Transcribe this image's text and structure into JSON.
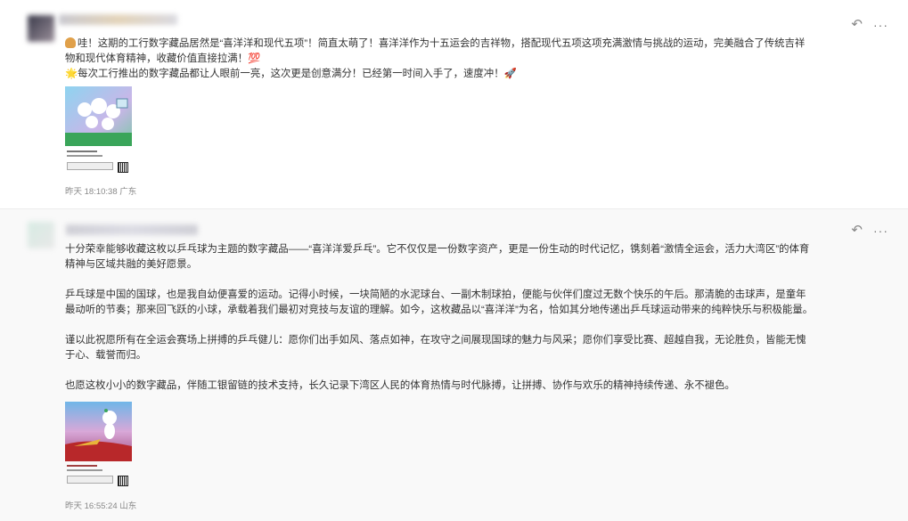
{
  "posts": [
    {
      "paragraphs": [
        "哇！这期的工行数字藏品居然是“喜洋洋和现代五项”！简直太萌了！喜洋洋作为十五运会的吉祥物，搭配现代五项这项充满激情与挑战的运动，完美融合了传统吉祥物和现代体育精神，收藏价值直接拉满！💯",
        "🌟每次工行推出的数字藏品都让人眼前一亮，这次更是创意满分！已经第一时间入手了，速度冲！🚀"
      ],
      "meta": "昨天 18:10:38 广东",
      "reply_icon": "reply-icon",
      "more_icon": "more-icon"
    },
    {
      "paragraphs": [
        "十分荣幸能够收藏这枚以乒乓球为主题的数字藏品——“喜洋洋爱乒乓”。它不仅仅是一份数字资产，更是一份生动的时代记忆，镌刻着“激情全运会，活力大湾区”的体育精神与区域共融的美好愿景。",
        "乒乓球是中国的国球，也是我自幼便喜爱的运动。记得小时候，一块简陋的水泥球台、一副木制球拍，便能与伙伴们度过无数个快乐的午后。那清脆的击球声，是童年最动听的节奏；那来回飞跃的小球，承载着我们最初对竞技与友谊的理解。如今，这枚藏品以“喜洋洋”为名，恰如其分地传递出乒乓球运动带来的纯粹快乐与积极能量。",
        "谨以此祝愿所有在全运会赛场上拼搏的乒乓健儿：愿你们出手如风、落点如神，在攻守之间展现国球的魅力与风采；愿你们享受比赛、超越自我，无论胜负，皆能无愧于心、载誉而归。",
        "也愿这枚小小的数字藏品，伴随工银留链的技术支持，长久记录下湾区人民的体育热情与时代脉搏，让拼搏、协作与欢乐的精神持续传递、永不褪色。"
      ],
      "meta": "昨天 16:55:24 山东",
      "reply_icon": "reply-icon",
      "more_icon": "more-icon"
    }
  ],
  "colors": {
    "text": "#333333",
    "meta": "#888888",
    "post2_bg": "#f9f9f9"
  }
}
